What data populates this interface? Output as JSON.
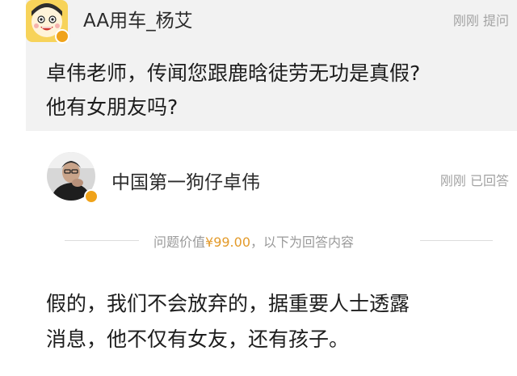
{
  "question": {
    "asker_name": "AA用车_杨艾",
    "meta": "刚刚 提问",
    "line1": "卓伟老师，传闻您跟鹿晗徒劳无功是真假?",
    "line2": "他有女朋友吗?"
  },
  "answerer": {
    "name": "中国第一狗仔卓伟",
    "meta": "刚刚 已回答"
  },
  "price": {
    "prefix": "问题价值",
    "amount": "¥99.00",
    "suffix": "，以下为回答内容"
  },
  "answer": {
    "line1": "假的，我们不会放弃的，据重要人士透露",
    "line2": "消息，他不仅有女友，还有孩子。"
  },
  "colors": {
    "price": "#e39a2a",
    "badge": "#f0a31a",
    "meta": "#a3a3a3"
  }
}
